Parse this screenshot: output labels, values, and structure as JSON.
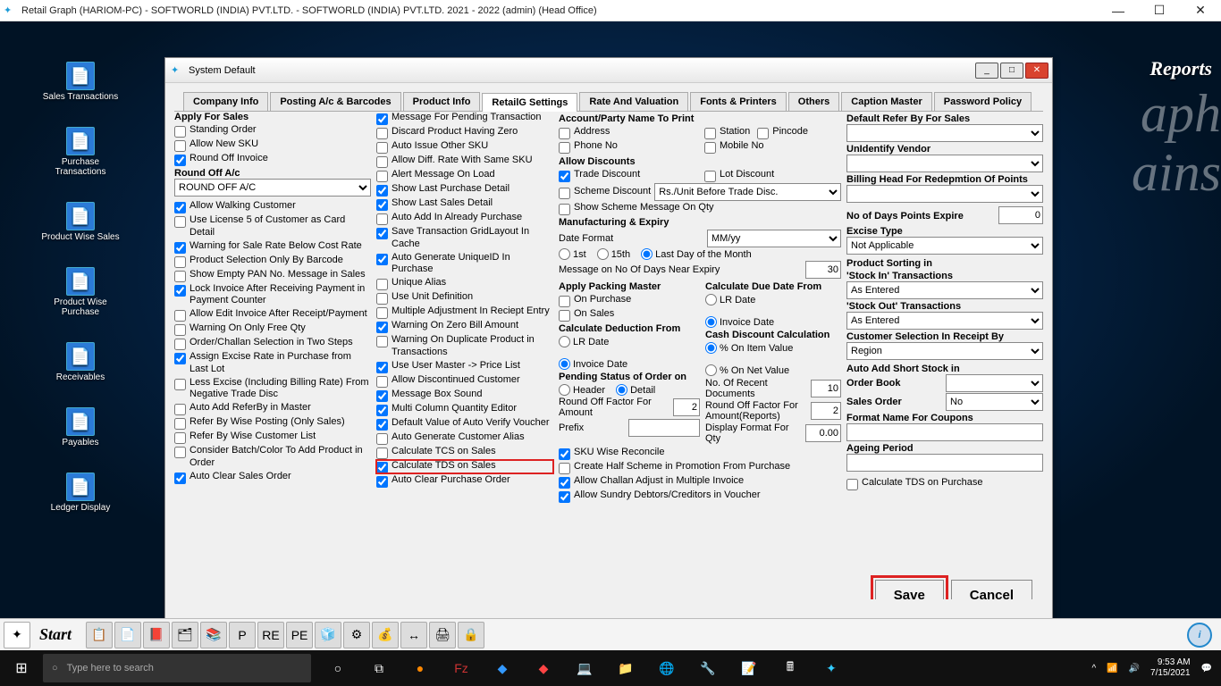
{
  "titlebar": {
    "text": "Retail Graph (HARIOM-PC) - SOFTWORLD (INDIA) PVT.LTD. - SOFTWORLD (INDIA) PVT.LTD.  2021 - 2022 (admin) (Head Office)"
  },
  "reports_label": "Reports",
  "watermark": [
    "aph",
    "ains"
  ],
  "desktop_icons": [
    {
      "label": "Sales Transactions",
      "name": "desk-sales-transactions"
    },
    {
      "label": "Purchase Transactions",
      "name": "desk-purchase-transactions"
    },
    {
      "label": "Product Wise Sales",
      "name": "desk-product-wise-sales"
    },
    {
      "label": "Product Wise Purchase",
      "name": "desk-product-wise-purchase"
    },
    {
      "label": "Receivables",
      "name": "desk-receivables"
    },
    {
      "label": "Payables",
      "name": "desk-payables"
    },
    {
      "label": "Ledger Display",
      "name": "desk-ledger-display"
    }
  ],
  "dialog": {
    "title": "System Default",
    "tabs": [
      "Company Info",
      "Posting A/c & Barcodes",
      "Product Info",
      "RetailG Settings",
      "Rate And Valuation",
      "Fonts & Printers",
      "Others",
      "Caption Master",
      "Password Policy"
    ],
    "active_tab": 3,
    "save": "Save",
    "cancel": "Cancel"
  },
  "col1": {
    "hdr": "Apply For Sales",
    "items": [
      {
        "label": "Standing Order",
        "checked": false
      },
      {
        "label": "Allow New SKU",
        "checked": false
      },
      {
        "label": "Round Off Invoice",
        "checked": true
      }
    ],
    "roundoff_label": "Round Off A/c",
    "roundoff_value": "ROUND OFF A/C",
    "items2": [
      {
        "label": "Allow Walking Customer",
        "checked": true
      },
      {
        "label": "Use License 5 of Customer as Card Detail",
        "checked": false
      },
      {
        "label": "Warning for Sale Rate Below Cost Rate",
        "checked": true
      },
      {
        "label": "Product Selection Only By Barcode",
        "checked": false
      },
      {
        "label": "Show Empty PAN No. Message in Sales",
        "checked": false
      },
      {
        "label": "Lock Invoice After Receiving  Payment in Payment Counter",
        "checked": true
      },
      {
        "label": "Allow Edit Invoice After Receipt/Payment",
        "checked": false
      },
      {
        "label": "Warning On Only Free Qty",
        "checked": false
      },
      {
        "label": "Order/Challan Selection in Two Steps",
        "checked": false
      },
      {
        "label": "Assign Excise Rate in Purchase from Last Lot",
        "checked": true
      },
      {
        "label": "Less Excise (Including Billing Rate) From Negative Trade Disc",
        "checked": false
      },
      {
        "label": "Auto Add ReferBy in Master",
        "checked": false
      },
      {
        "label": "Refer By Wise Posting (Only Sales)",
        "checked": false
      },
      {
        "label": "Refer By Wise Customer List",
        "checked": false
      },
      {
        "label": "Consider Batch/Color To Add Product in Order",
        "checked": false
      },
      {
        "label": "Auto Clear Sales Order",
        "checked": true
      }
    ]
  },
  "col2": {
    "items": [
      {
        "label": "Message For Pending Transaction",
        "checked": true
      },
      {
        "label": "Discard Product Having Zero",
        "checked": false
      },
      {
        "label": "Auto Issue Other SKU",
        "checked": false
      },
      {
        "label": "Allow Diff. Rate With Same SKU",
        "checked": false
      },
      {
        "label": "Alert Message On Load",
        "checked": false
      },
      {
        "label": "Show Last Purchase Detail",
        "checked": true
      },
      {
        "label": "Show Last Sales Detail",
        "checked": true
      },
      {
        "label": "Auto Add In Already Purchase",
        "checked": false
      },
      {
        "label": "Save Transaction GridLayout In Cache",
        "checked": true
      },
      {
        "label": "Auto Generate UniqueID In Purchase",
        "checked": true
      },
      {
        "label": "Unique Alias",
        "checked": false
      },
      {
        "label": "Use Unit Definition",
        "checked": false
      },
      {
        "label": "Multiple Adjustment In Reciept Entry",
        "checked": false
      },
      {
        "label": "Warning On Zero Bill Amount",
        "checked": true
      },
      {
        "label": "Warning On Duplicate Product in Transactions",
        "checked": false
      },
      {
        "label": "Use User Master -> Price List",
        "checked": true
      },
      {
        "label": "Allow Discontinued Customer",
        "checked": false
      },
      {
        "label": "Message Box Sound",
        "checked": true
      },
      {
        "label": "Multi Column Quantity Editor",
        "checked": true
      },
      {
        "label": "Default Value of Auto Verify Voucher",
        "checked": true
      },
      {
        "label": "Auto Generate Customer Alias",
        "checked": false
      },
      {
        "label": "Calculate TCS on Sales",
        "checked": false
      },
      {
        "label": "Calculate TDS on Sales",
        "checked": true,
        "highlight": true
      },
      {
        "label": "Auto Clear Purchase Order",
        "checked": true
      }
    ]
  },
  "col3": {
    "acct_hdr": "Account/Party Name To Print",
    "acct": [
      {
        "label": "Address",
        "checked": false
      },
      {
        "label": "Phone No",
        "checked": false
      },
      {
        "label": "Station",
        "checked": false
      },
      {
        "label": "Pincode",
        "checked": false
      },
      {
        "label": "Mobile No",
        "checked": false
      }
    ],
    "allow_disc_hdr": "Allow Discounts",
    "trade_discount": {
      "label": "Trade Discount",
      "checked": true
    },
    "lot_discount": {
      "label": "Lot Discount",
      "checked": false
    },
    "scheme_discount": {
      "label": "Scheme Discount",
      "checked": false
    },
    "scheme_sel": "Rs./Unit Before Trade Disc.",
    "show_scheme": {
      "label": "Show Scheme Message On Qty",
      "checked": false
    },
    "mfg_hdr": "Manufacturing & Expiry",
    "date_format_lbl": "Date Format",
    "date_format": "MM/yy",
    "date_opts": [
      "1st",
      "15th",
      "Last  Day of the Month"
    ],
    "date_opt_sel": 2,
    "msg_on_lbl": "Message on  No Of Days Near Expiry",
    "msg_on_val": "30",
    "packing_hdr": "Apply Packing Master",
    "packing": [
      {
        "label": "On Purchase",
        "checked": false
      },
      {
        "label": "On Sales",
        "checked": false
      }
    ],
    "due_hdr": "Calculate Due Date From",
    "due_opts": [
      "LR Date",
      "Invoice Date"
    ],
    "due_sel": 1,
    "deduct_hdr": "Calculate Deduction From",
    "deduct_opts": [
      "LR Date",
      "Invoice Date"
    ],
    "deduct_sel": 1,
    "cash_hdr": "Cash Discount Calculation",
    "cash_opts": [
      "% On Item Value",
      "% On Net Value"
    ],
    "cash_sel": 0,
    "pending_hdr": "Pending Status of Order on",
    "pending_opts": [
      "Header",
      "Detail"
    ],
    "pending_sel": 1,
    "recent_lbl": "No. Of Recent Documents",
    "recent_val": "10",
    "rof_lbl": "Round Off Factor For Amount",
    "rof_val": "2",
    "rofr_lbl": "Round Off Factor For Amount(Reports)",
    "rofr_val": "2",
    "prefix_lbl": "Prefix",
    "prefix_val": "",
    "dfq_lbl": "Display Format For Qty",
    "dfq_val": "0.00",
    "bottom": [
      {
        "label": "SKU Wise Reconcile",
        "checked": true
      },
      {
        "label": "Create Half Scheme in Promotion From Purchase",
        "checked": false
      },
      {
        "label": "Allow Challan Adjust in Multiple Invoice",
        "checked": true
      },
      {
        "label": "Allow Sundry Debtors/Creditors in Voucher",
        "checked": true
      }
    ]
  },
  "col4": {
    "referby_lbl": "Default Refer By For Sales",
    "referby_val": "",
    "unid_lbl": "UnIdentify Vendor",
    "unid_val": "",
    "billing_lbl": "Billing Head For Redepmtion Of Points",
    "billing_val": "",
    "days_lbl": "No of Days Points Expire",
    "days_val": "0",
    "excise_lbl": "Excise Type",
    "excise_val": "Not Applicable",
    "psort_hdr": "Product Sorting in",
    "stockin_lbl": "'Stock In' Transactions",
    "stockin_val": "As Entered",
    "stockout_lbl": "'Stock Out' Transactions",
    "stockout_val": "As Entered",
    "cust_lbl": "Customer Selection In Receipt By",
    "cust_val": "Region",
    "auto_hdr": "Auto Add Short Stock in",
    "orderbook_lbl": "Order Book",
    "orderbook_val": "",
    "salesorder_lbl": "Sales Order",
    "salesorder_val": "No",
    "coupons_lbl": "Format Name For Coupons",
    "coupons_val": "",
    "ageing_lbl": "Ageing Period",
    "ageing_val": "",
    "tds_purchase": {
      "label": "Calculate TDS on Purchase",
      "checked": false
    }
  },
  "launcher": {
    "start": "Start"
  },
  "taskbar": {
    "search_placeholder": "Type here to search",
    "time": "9:53 AM",
    "date": "7/15/2021"
  }
}
